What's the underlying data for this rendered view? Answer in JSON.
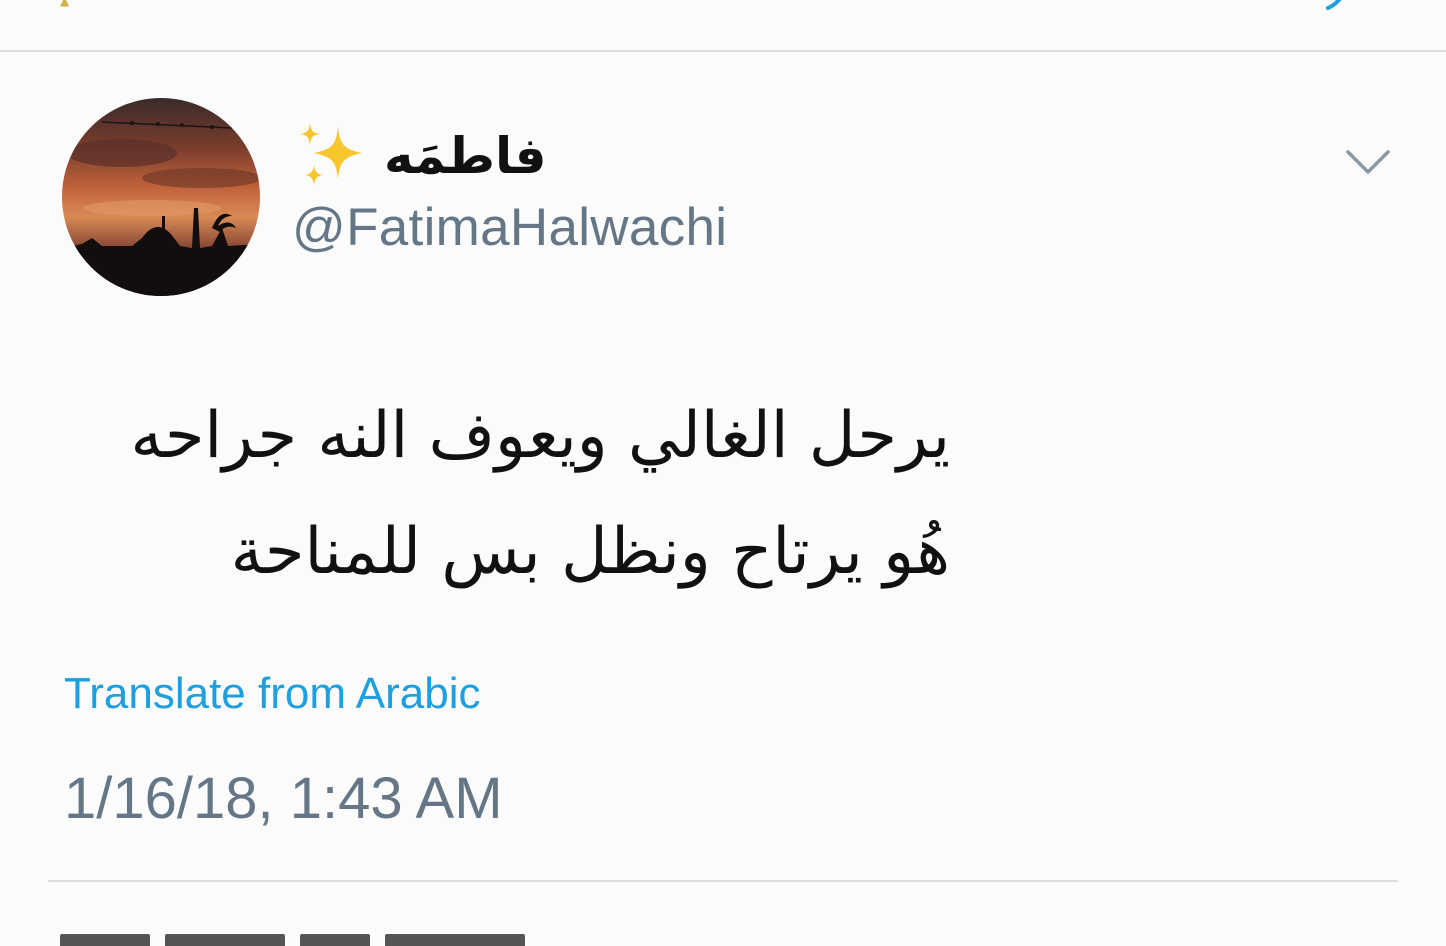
{
  "tweet": {
    "author": {
      "display_name": "فاطمَه",
      "emoji": "sparkles-emoji",
      "handle": "@FatimaHalwachi"
    },
    "text_lines": [
      "يرحل الغالي ويعوف النه جراحه",
      "هُو يرتاح ونظل بس للمناحة"
    ],
    "translate_label": "Translate from Arabic",
    "timestamp": "1/16/18, 1:43 AM",
    "menu_icon": "chevron-down-icon"
  },
  "colors": {
    "background": "#fbfbfb",
    "link": "#1d9fe0",
    "secondary_text": "#657786",
    "primary_text": "#111111",
    "divider": "#dcdcdc"
  }
}
